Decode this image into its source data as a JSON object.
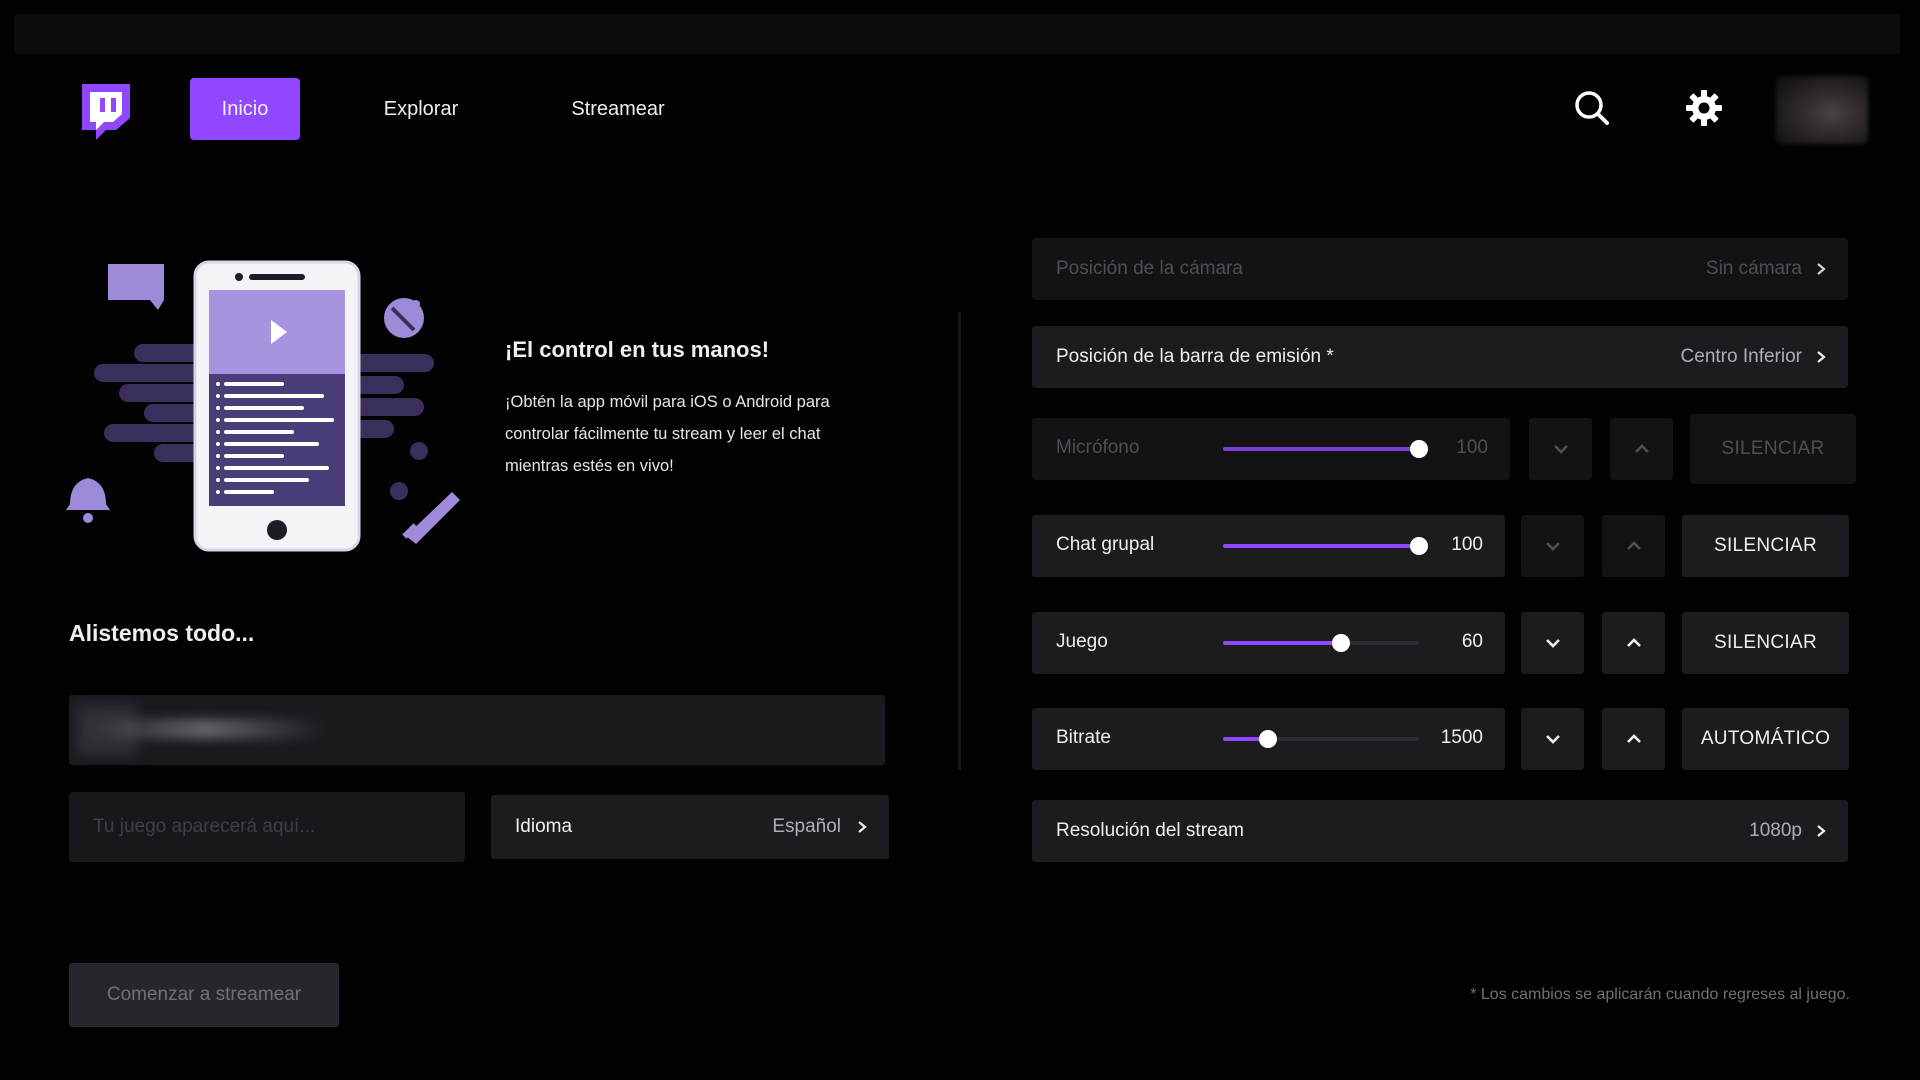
{
  "header": {
    "tabs": [
      {
        "label": "Inicio",
        "active": true
      },
      {
        "label": "Explorar",
        "active": false
      },
      {
        "label": "Streamear",
        "active": false
      }
    ],
    "icons": [
      "search-icon",
      "gear-icon"
    ]
  },
  "promo": {
    "title": "¡El control en tus manos!",
    "text": "¡Obtén la app móvil para iOS o Android para controlar fácilmente tu stream y leer el chat mientras estés en vivo!"
  },
  "setup": {
    "heading": "Alistemos todo...",
    "game_placeholder": "Tu juego aparecerá aquí...",
    "language_label": "Idioma",
    "language_value": "Español",
    "start_button": "Comenzar a streamear"
  },
  "settings": {
    "camera": {
      "label": "Posición de la cámara",
      "value": "Sin cámara",
      "enabled": false
    },
    "bar": {
      "label": "Posición de la barra de emisión *",
      "value": "Centro Inferior",
      "enabled": true
    },
    "sliders": [
      {
        "label": "Micrófono",
        "value": "100",
        "level": 1.0,
        "enabled": false,
        "action": "SILENCIAR"
      },
      {
        "label": "Chat grupal",
        "value": "100",
        "level": 1.0,
        "enabled": true,
        "arrows_enabled": false,
        "action": "SILENCIAR"
      },
      {
        "label": "Juego",
        "value": "60",
        "level": 0.6,
        "enabled": true,
        "arrows_enabled": true,
        "action": "SILENCIAR"
      },
      {
        "label": "Bitrate",
        "value": "1500",
        "level": 0.23,
        "enabled": true,
        "arrows_enabled": true,
        "action": "AUTOMÁTICO"
      }
    ],
    "resolution": {
      "label": "Resolución del stream",
      "value": "1080p"
    }
  },
  "footnote": "* Los cambios se aplicarán cuando regreses al juego.",
  "colors": {
    "accent": "#9147ff",
    "background": "#020203",
    "panel": "#1c1c20"
  }
}
